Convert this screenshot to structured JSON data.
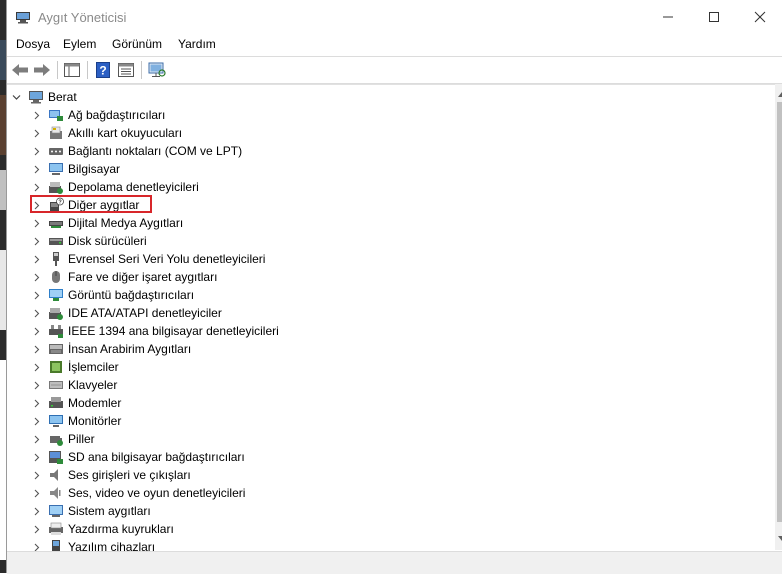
{
  "window": {
    "title": "Aygıt Yöneticisi",
    "minimize_label": "—",
    "maximize_label": "☐",
    "close_label": "✕"
  },
  "menu": {
    "items": [
      "Dosya",
      "Eylem",
      "Görünüm",
      "Yardım"
    ]
  },
  "toolbar": {
    "buttons": [
      "back-arrow-icon",
      "forward-arrow-icon",
      "show-hide-console-tree-icon",
      "help-icon",
      "properties-view-icon",
      "monitor-scan-icon"
    ]
  },
  "tree": {
    "root": "Berat",
    "items": [
      {
        "label": "Ağ bağdaştırıcıları",
        "icon": "network-adapter-icon"
      },
      {
        "label": "Akıllı kart okuyucuları",
        "icon": "smart-card-reader-icon"
      },
      {
        "label": "Bağlantı noktaları (COM ve LPT)",
        "icon": "port-icon"
      },
      {
        "label": "Bilgisayar",
        "icon": "computer-icon"
      },
      {
        "label": "Depolama denetleyicileri",
        "icon": "storage-controller-icon"
      },
      {
        "label": "Diğer aygıtlar",
        "icon": "other-devices-icon"
      },
      {
        "label": "Dijital Medya Aygıtları",
        "icon": "digital-media-icon"
      },
      {
        "label": "Disk sürücüleri",
        "icon": "disk-drive-icon"
      },
      {
        "label": "Evrensel Seri Veri Yolu denetleyicileri",
        "icon": "usb-controller-icon"
      },
      {
        "label": "Fare ve diğer işaret aygıtları",
        "icon": "mouse-icon"
      },
      {
        "label": "Görüntü bağdaştırıcıları",
        "icon": "display-adapter-icon"
      },
      {
        "label": "IDE ATA/ATAPI denetleyiciler",
        "icon": "ide-controller-icon"
      },
      {
        "label": "IEEE 1394 ana bilgisayar denetleyicileri",
        "icon": "ieee1394-icon"
      },
      {
        "label": "İnsan Arabirim Aygıtları",
        "icon": "hid-icon"
      },
      {
        "label": "İşlemciler",
        "icon": "processor-icon"
      },
      {
        "label": "Klavyeler",
        "icon": "keyboard-icon"
      },
      {
        "label": "Modemler",
        "icon": "modem-icon"
      },
      {
        "label": "Monitörler",
        "icon": "monitor-icon"
      },
      {
        "label": "Piller",
        "icon": "battery-icon"
      },
      {
        "label": "SD ana bilgisayar bağdaştırıcıları",
        "icon": "sd-host-icon"
      },
      {
        "label": "Ses girişleri ve çıkışları",
        "icon": "audio-io-icon"
      },
      {
        "label": "Ses, video ve oyun denetleyicileri",
        "icon": "sound-video-game-icon"
      },
      {
        "label": "Sistem aygıtları",
        "icon": "system-device-icon"
      },
      {
        "label": "Yazdırma kuyrukları",
        "icon": "print-queue-icon"
      },
      {
        "label": "Yazılım cihazları",
        "icon": "software-device-icon"
      }
    ],
    "highlighted": "Diğer aygıtlar"
  },
  "colors": {
    "highlight_border": "#d8262a",
    "title_text": "#8a8a8a"
  }
}
